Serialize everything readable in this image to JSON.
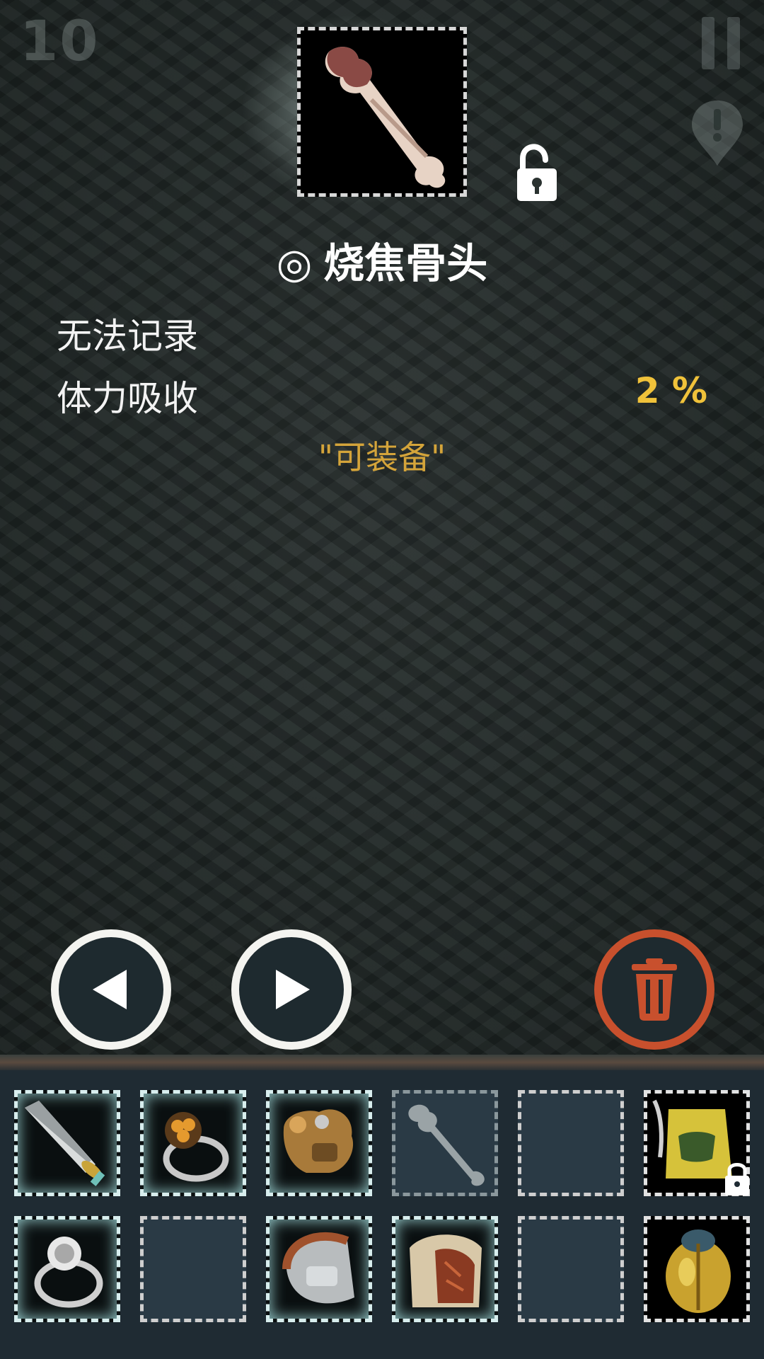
{
  "hud": {
    "level": "10",
    "pause_icon": "pause-icon",
    "alert_icon": "alert-marker-icon"
  },
  "item": {
    "icon": "charred-bone-icon",
    "lock_icon": "unlocked-padlock-icon",
    "title_mark": "◎",
    "name": "烧焦骨头",
    "stats": [
      {
        "label": "无法记录",
        "value": ""
      },
      {
        "label": "体力吸收",
        "value": "2 %"
      }
    ],
    "note": "\"可装备\""
  },
  "controls": {
    "prev_icon": "arrow-left-icon",
    "next_icon": "arrow-right-icon",
    "delete_icon": "trash-icon"
  },
  "colors": {
    "accent_gold": "#f0c23a",
    "note_gold": "#d4a43a",
    "delete_red": "#c8502d",
    "inventory_bg": "#1f2b33"
  },
  "inventory": {
    "row1": [
      {
        "icon": "sword-icon",
        "state": "equipped"
      },
      {
        "icon": "gem-ring-icon",
        "state": "equipped"
      },
      {
        "icon": "golden-gauntlet-icon",
        "state": "equipped"
      },
      {
        "icon": "bone-icon",
        "state": "selected-ghost"
      },
      {
        "icon": "",
        "state": "empty"
      },
      {
        "icon": "golden-armor-icon",
        "state": "locked"
      }
    ],
    "row2": [
      {
        "icon": "silver-ring-icon",
        "state": "equipped"
      },
      {
        "icon": "",
        "state": "empty"
      },
      {
        "icon": "steel-bracer-icon",
        "state": "equipped"
      },
      {
        "icon": "leather-armor-icon",
        "state": "equipped"
      },
      {
        "icon": "",
        "state": "empty"
      },
      {
        "icon": "golden-scarab-icon",
        "state": "normal"
      }
    ]
  }
}
